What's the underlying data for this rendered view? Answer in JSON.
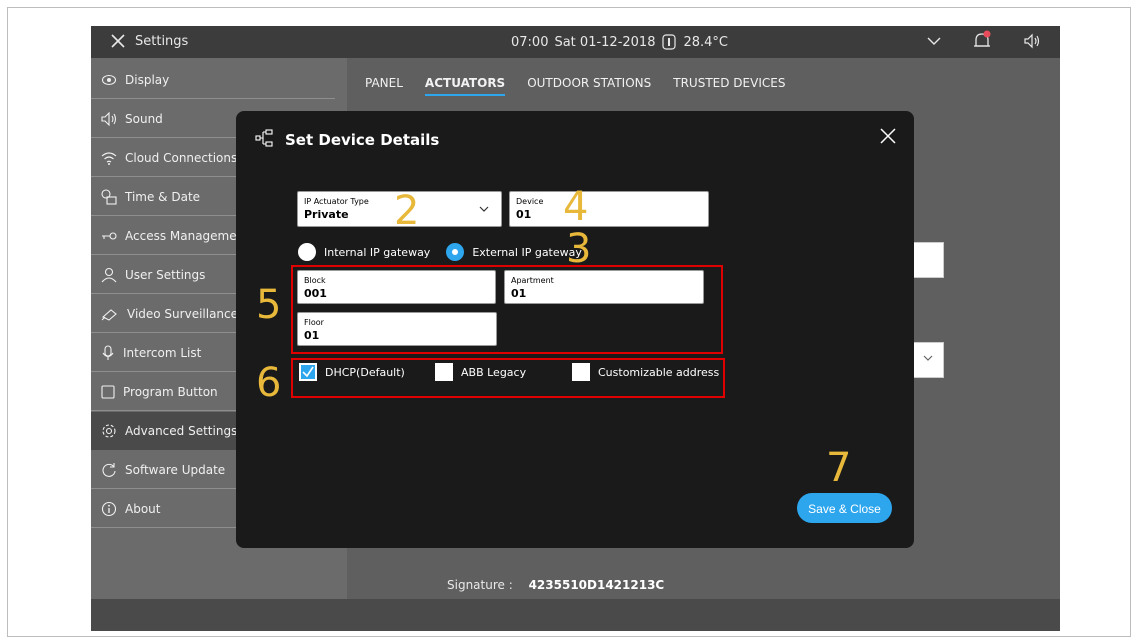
{
  "statusbar": {
    "title": "Settings",
    "time": "07:00",
    "date": "Sat 01-12-2018",
    "temperature": "28.4°C"
  },
  "sidebar": {
    "items": [
      {
        "label": "Display",
        "icon": "eye-icon"
      },
      {
        "label": "Sound",
        "icon": "speaker-icon"
      },
      {
        "label": "Cloud Connections",
        "icon": "wifi-icon"
      },
      {
        "label": "Time & Date",
        "icon": "clock-icon"
      },
      {
        "label": "Access Manageme",
        "icon": "key-icon"
      },
      {
        "label": "User Settings",
        "icon": "user-icon"
      },
      {
        "label": "Video Surveillance",
        "icon": "camera-icon"
      },
      {
        "label": "Intercom List",
        "icon": "microphone-icon"
      },
      {
        "label": "Program Button",
        "icon": "square-icon"
      },
      {
        "label": "Advanced Settings",
        "icon": "gear-icon"
      },
      {
        "label": "Software Update",
        "icon": "refresh-icon"
      },
      {
        "label": "About",
        "icon": "info-icon"
      }
    ],
    "active_index": 9
  },
  "tabs": [
    "PANEL",
    "ACTUATORS",
    "OUTDOOR STATIONS",
    "TRUSTED DEVICES"
  ],
  "active_tab": 1,
  "signature": {
    "label": "Signature :",
    "value": "4235510D1421213C"
  },
  "modal": {
    "title": "Set Device Details",
    "actuator_type": {
      "label": "IP Actuator Type",
      "value": "Private"
    },
    "device": {
      "label": "Device",
      "value": "01"
    },
    "radios": [
      {
        "label": "Internal IP gateway",
        "selected": false
      },
      {
        "label": "External IP gateway",
        "selected": true
      }
    ],
    "block": {
      "label": "Block",
      "value": "001"
    },
    "apartment": {
      "label": "Apartment",
      "value": "01"
    },
    "floor": {
      "label": "Floor",
      "value": "01"
    },
    "checkboxes": [
      {
        "label": "DHCP(Default)",
        "checked": true
      },
      {
        "label": "ABB Legacy",
        "checked": false
      },
      {
        "label": "Customizable address",
        "checked": false
      }
    ],
    "save_label": "Save & Close"
  },
  "annotations": [
    "2",
    "3",
    "4",
    "5",
    "6",
    "7"
  ],
  "colors": {
    "accent": "#2da6ee",
    "highlight": "#e00000",
    "annotation": "#e8b83a"
  }
}
